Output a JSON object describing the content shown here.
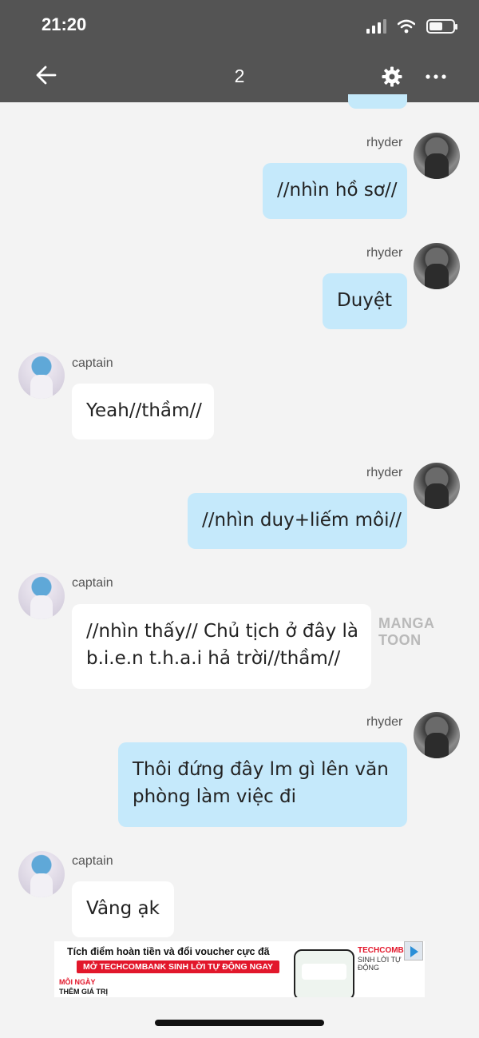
{
  "status_bar": {
    "time": "21:20"
  },
  "header": {
    "title": "2",
    "back_icon": "arrow-left-icon",
    "settings_icon": "gear-icon",
    "more_icon": "more-horizontal-icon"
  },
  "messages": [
    {
      "sender": "rhyder",
      "side": "right",
      "text": "//nhìn hồ sơ//"
    },
    {
      "sender": "rhyder",
      "side": "right",
      "text": "Duyệt"
    },
    {
      "sender": "captain",
      "side": "left",
      "text": "Yeah//thầm//"
    },
    {
      "sender": "rhyder",
      "side": "right",
      "text": "//nhìn duy+liếm môi//"
    },
    {
      "sender": "captain",
      "side": "left",
      "lines": [
        "//nhìn thấy// Chủ tịch ở đây là",
        "b.i.e.n t.h.a.i hả trời//thầm//"
      ]
    },
    {
      "sender": "rhyder",
      "side": "right",
      "lines": [
        "Thôi đứng đây lm gì lên văn",
        "phòng làm việc đi"
      ]
    },
    {
      "sender": "captain",
      "side": "left",
      "text": "Vâng ạk"
    }
  ],
  "watermark": "MANGA TOON",
  "ad": {
    "headline": "Tích điểm hoàn tiền và đổi voucher cực đã",
    "cta": "MỞ TECHCOMBANK SINH LỜI TỰ ĐỘNG NGAY",
    "sub_line1": "MỖI NGÀY",
    "sub_line2": "THÊM GIÁ TRỊ",
    "brand": "TECHCOMBANK",
    "tagline": "SINH LỜI TỰ ĐỘNG"
  },
  "colors": {
    "header_bg": "#545454",
    "my_bubble": "#c5e9fb",
    "their_bubble": "#ffffff",
    "page_bg": "#f3f3f3"
  }
}
